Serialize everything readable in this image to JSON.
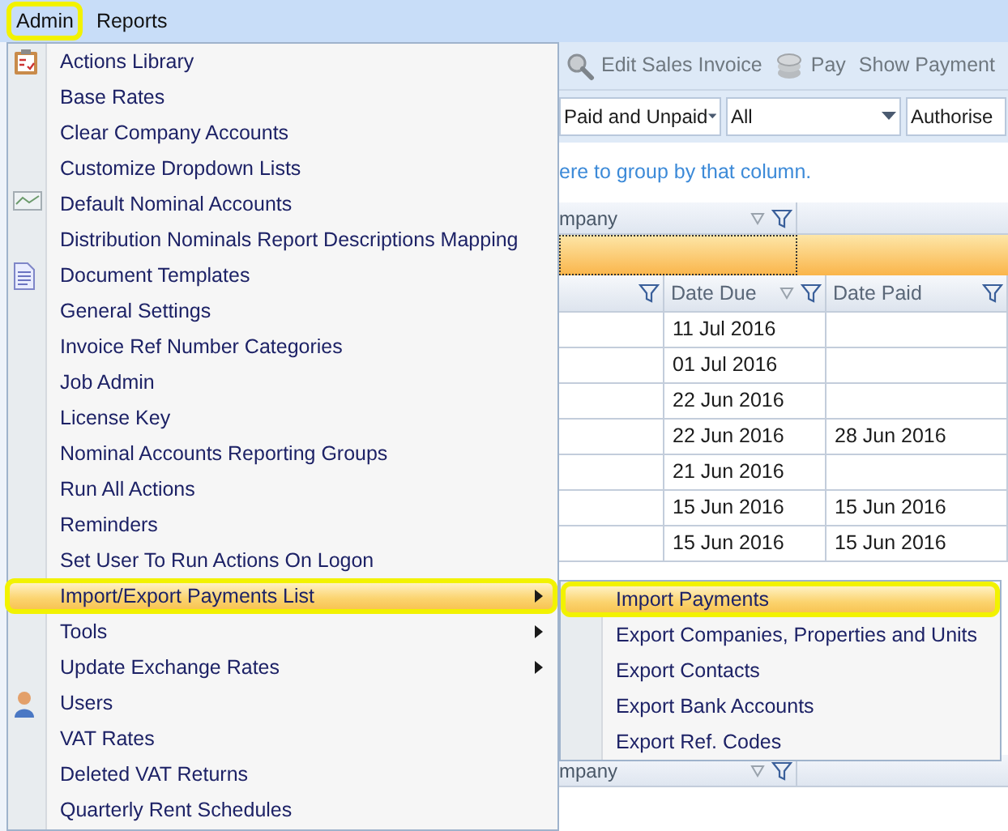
{
  "menubar": [
    {
      "label": "Admin",
      "selected": true
    },
    {
      "label": "Reports",
      "selected": false
    }
  ],
  "toolbar": [
    {
      "label": "Edit Sales Invoice",
      "kind": "icon"
    },
    {
      "label": "Pay",
      "kind": "icon"
    },
    {
      "label": "Show Payment",
      "kind": "plain"
    }
  ],
  "filters": [
    {
      "value": "Paid and Unpaid",
      "dropdown": true
    },
    {
      "value": "All",
      "dropdown": true
    },
    {
      "value": "Authorise",
      "dropdown": false
    }
  ],
  "group_panel": {
    "hint": "ere to group by that column."
  },
  "group_header": {
    "label": "mpany"
  },
  "columns": [
    {
      "label": "Date Due",
      "sorted": true
    },
    {
      "label": "Date Paid",
      "sorted": false
    }
  ],
  "rows": [
    {
      "date_due": "11 Jul 2016"
    },
    {
      "date_due": "01 Jul 2016"
    },
    {
      "date_due": "22 Jun 2016"
    },
    {
      "date_due": "22 Jun 2016",
      "date_paid": "28 Jun 2016"
    },
    {
      "date_due": "21 Jun 2016"
    },
    {
      "date_due": "15 Jun 2016",
      "date_paid": "15 Jun 2016"
    },
    {
      "date_due": "15 Jun 2016",
      "date_paid": "15 Jun 2016"
    }
  ],
  "lower_group_header": {
    "label": "mpany"
  },
  "admin_menu": {
    "items": [
      {
        "label": "Actions Library",
        "kind": "icon",
        "submenu": false,
        "selected": false
      },
      {
        "label": "Base Rates",
        "submenu": false,
        "selected": false
      },
      {
        "label": "Clear Company Accounts",
        "submenu": false,
        "selected": false
      },
      {
        "label": "Customize Dropdown Lists",
        "submenu": false,
        "selected": false
      },
      {
        "label": "Default Nominal Accounts",
        "kind": "icon",
        "submenu": false,
        "selected": false
      },
      {
        "label": "Distribution Nominals Report Descriptions Mapping",
        "submenu": false,
        "selected": false
      },
      {
        "label": "Document Templates",
        "kind": "icon",
        "submenu": false,
        "selected": false
      },
      {
        "label": "General Settings",
        "submenu": false,
        "selected": false
      },
      {
        "label": "Invoice Ref Number Categories",
        "submenu": false,
        "selected": false
      },
      {
        "label": "Job Admin",
        "submenu": false,
        "selected": false
      },
      {
        "label": "License Key",
        "submenu": false,
        "selected": false
      },
      {
        "label": "Nominal Accounts Reporting Groups",
        "submenu": false,
        "selected": false
      },
      {
        "label": "Run All Actions",
        "submenu": false,
        "selected": false
      },
      {
        "label": "Reminders",
        "submenu": false,
        "selected": false
      },
      {
        "label": "Set User To Run Actions On Logon",
        "submenu": false,
        "selected": false
      },
      {
        "label": "Import/Export Payments List",
        "submenu": true,
        "selected": true
      },
      {
        "label": "Tools",
        "submenu": true,
        "selected": false
      },
      {
        "label": "Update Exchange Rates",
        "submenu": true,
        "selected": false
      },
      {
        "label": "Users",
        "kind": "icon",
        "submenu": false,
        "selected": false
      },
      {
        "label": "VAT Rates",
        "submenu": false,
        "selected": false
      },
      {
        "label": "Deleted VAT Returns",
        "submenu": false,
        "selected": false
      },
      {
        "label": "Quarterly Rent Schedules",
        "submenu": false,
        "selected": false
      }
    ]
  },
  "submenu": {
    "items": [
      {
        "label": "Import Payments",
        "selected": true
      },
      {
        "label": "Export Companies, Properties and Units",
        "selected": false
      },
      {
        "label": "Export Contacts",
        "selected": false
      },
      {
        "label": "Export Bank Accounts",
        "selected": false
      },
      {
        "label": "Export  Ref. Codes",
        "selected": false
      }
    ]
  }
}
